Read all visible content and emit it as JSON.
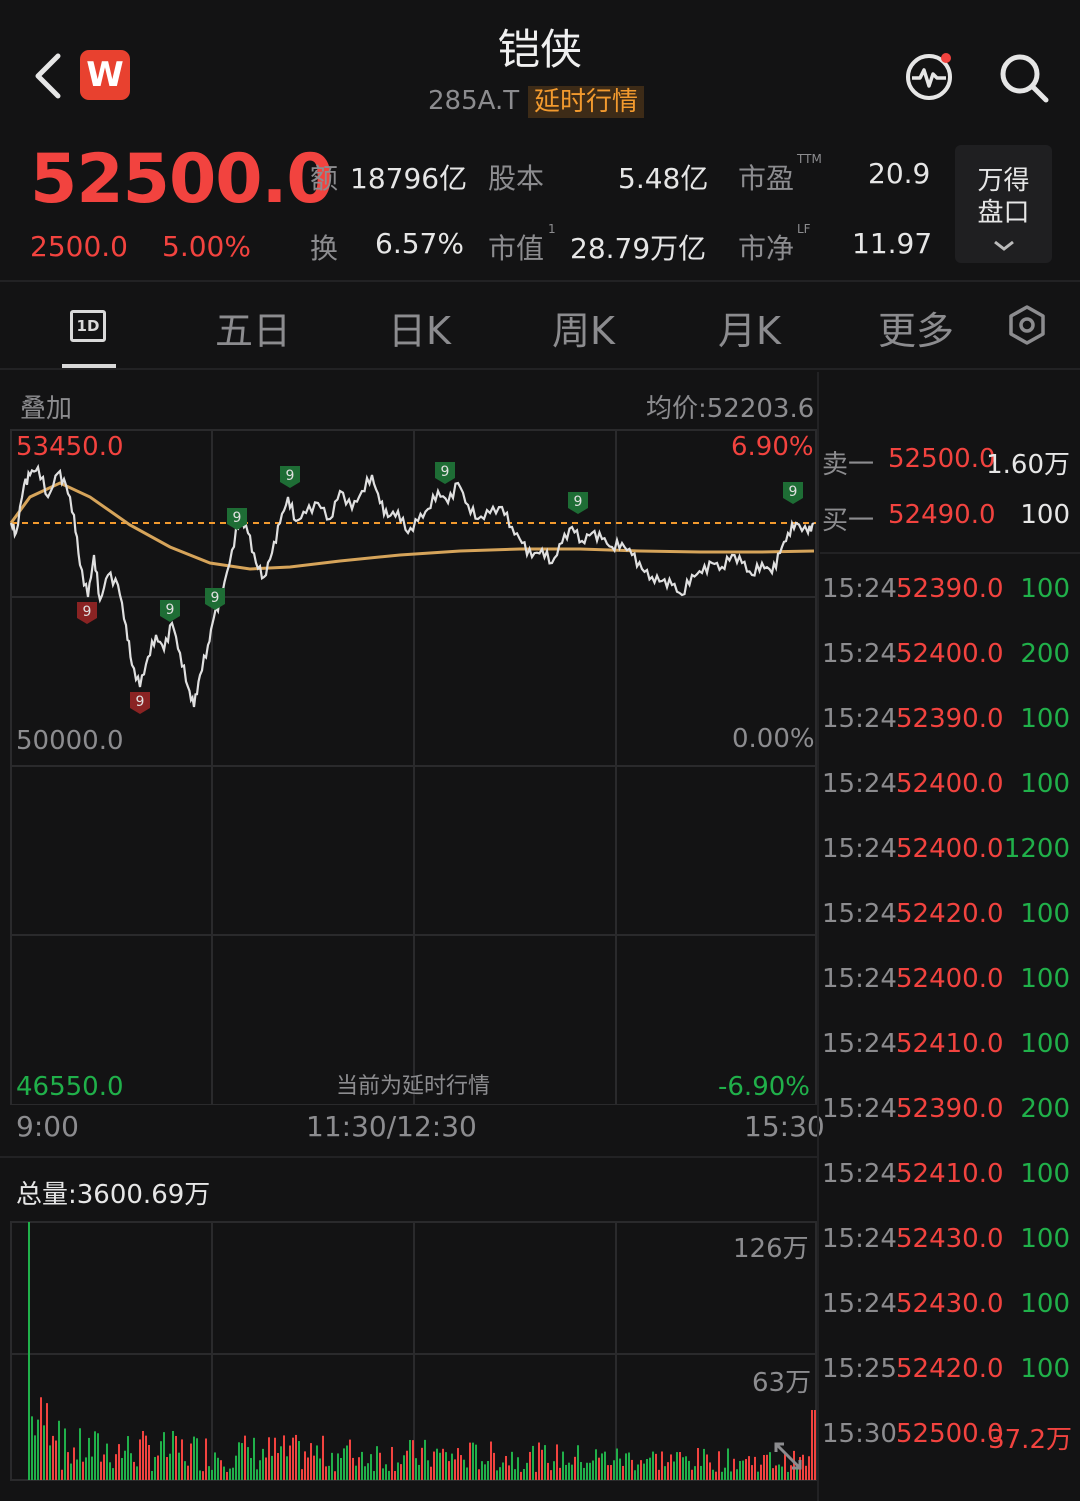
{
  "header": {
    "title": "铠侠",
    "code": "285A.T",
    "delay_tag": "延时行情",
    "logo": "W"
  },
  "quote": {
    "price": "52500.0",
    "change": "2500.0",
    "change_pct": "5.00%",
    "stats": [
      {
        "label": "额",
        "value": "18796亿",
        "sup": ""
      },
      {
        "label": "股本",
        "value": "5.48亿",
        "sup": ""
      },
      {
        "label": "市盈",
        "value": "20.9",
        "sup": "TTM"
      },
      {
        "label": "换",
        "value": "6.57%",
        "sup": ""
      },
      {
        "label": "市值",
        "value": "28.79万亿",
        "sup": "1"
      },
      {
        "label": "市净",
        "value": "11.97",
        "sup": "LF"
      }
    ],
    "wd_button": {
      "line1": "万得",
      "line2": "盘口"
    }
  },
  "tabs": {
    "active": "1D",
    "items": [
      "五日",
      "日K",
      "周K",
      "月K",
      "更多"
    ]
  },
  "chart": {
    "overlay_label": "叠加",
    "avg_price": "均价:52203.6",
    "y_high": "53450.0",
    "y_mid": "50000.0",
    "y_low": "46550.0",
    "pct_high": "6.90%",
    "pct_mid": "0.00%",
    "pct_low": "-6.90%",
    "delayed_note": "当前为延时行情",
    "time_start": "9:00",
    "time_mid": "11:30/12:30",
    "time_end": "15:30",
    "marker_text": "9"
  },
  "volume": {
    "total": "总量:3600.69万",
    "max_label": "126万",
    "mid_label": "63万"
  },
  "order_book": {
    "ask": {
      "label": "卖一",
      "price": "52500.0",
      "volume": "1.60万"
    },
    "bid": {
      "label": "买一",
      "price": "52490.0",
      "volume": "100"
    }
  },
  "ticks": [
    {
      "time": "15:24",
      "price": "52390.0",
      "volume": "100"
    },
    {
      "time": "15:24",
      "price": "52400.0",
      "volume": "200"
    },
    {
      "time": "15:24",
      "price": "52390.0",
      "volume": "100"
    },
    {
      "time": "15:24",
      "price": "52400.0",
      "volume": "100"
    },
    {
      "time": "15:24",
      "price": "52400.0",
      "volume": "1200"
    },
    {
      "time": "15:24",
      "price": "52420.0",
      "volume": "100"
    },
    {
      "time": "15:24",
      "price": "52400.0",
      "volume": "100"
    },
    {
      "time": "15:24",
      "price": "52410.0",
      "volume": "100"
    },
    {
      "time": "15:24",
      "price": "52390.0",
      "volume": "200"
    },
    {
      "time": "15:24",
      "price": "52410.0",
      "volume": "100"
    },
    {
      "time": "15:24",
      "price": "52430.0",
      "volume": "100"
    },
    {
      "time": "15:24",
      "price": "52430.0",
      "volume": "100"
    },
    {
      "time": "15:25",
      "price": "52420.0",
      "volume": "100"
    },
    {
      "time": "15:30",
      "price": "52500.0",
      "volume": "37.2万"
    }
  ],
  "colors": {
    "up": "#f2433f",
    "down": "#20b04a",
    "avg_line": "#d6a45a",
    "price_line": "#e0e0e0"
  },
  "icons": [
    "back-icon",
    "pulse-icon",
    "search-icon",
    "settings-icon",
    "expand-icon"
  ]
}
